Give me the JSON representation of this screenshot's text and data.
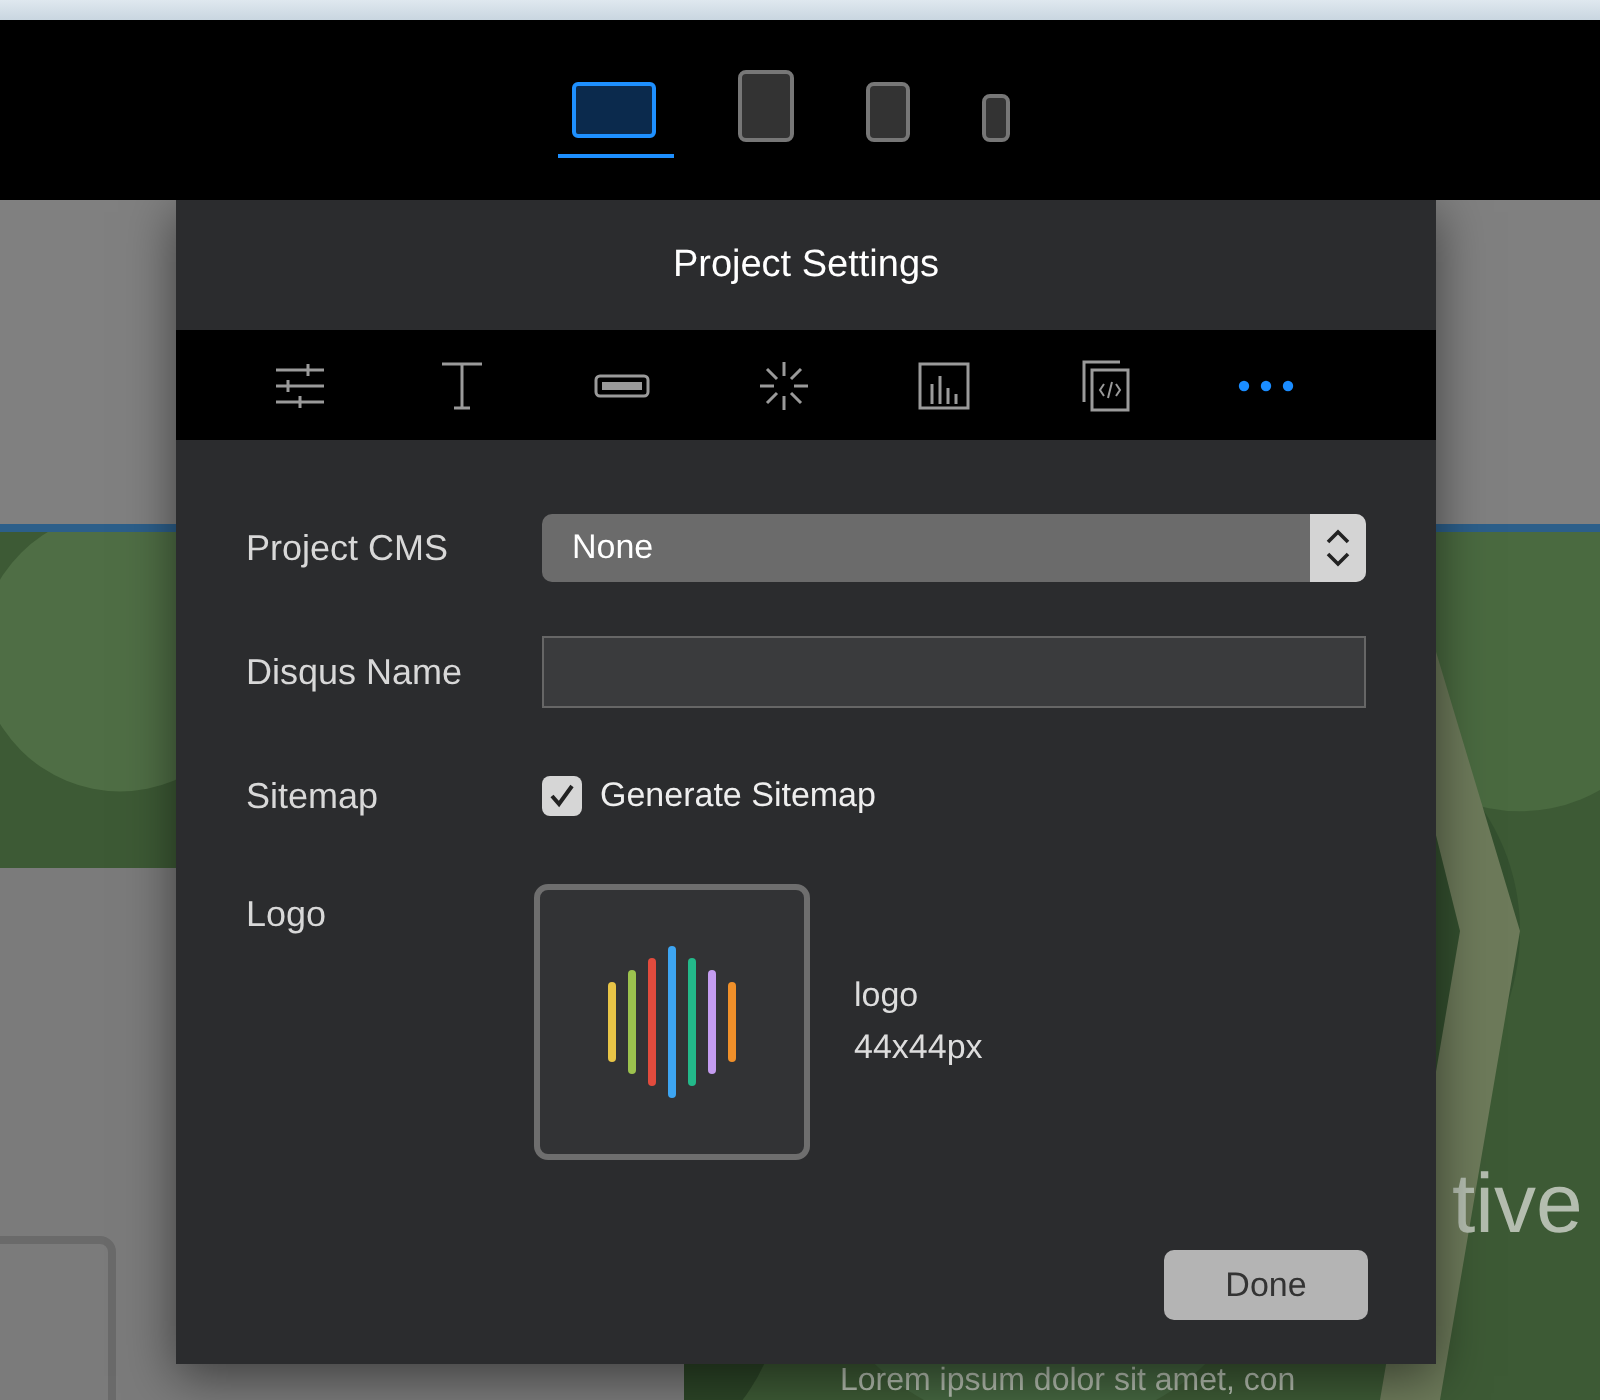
{
  "device_bar": {
    "devices": [
      {
        "kind": "laptop",
        "selected": true
      },
      {
        "kind": "tablet",
        "selected": false
      },
      {
        "kind": "small-tablet",
        "selected": false
      },
      {
        "kind": "phone",
        "selected": false
      }
    ]
  },
  "background_page": {
    "heading_fragment": "tive",
    "body_fragment": "Lorem ipsum dolor sit amet, con"
  },
  "dialog": {
    "title": "Project Settings",
    "tabs": [
      {
        "kind": "sliders",
        "selected": false
      },
      {
        "kind": "text",
        "selected": false
      },
      {
        "kind": "button",
        "selected": false
      },
      {
        "kind": "spinner",
        "selected": false
      },
      {
        "kind": "chart",
        "selected": false
      },
      {
        "kind": "code",
        "selected": false
      },
      {
        "kind": "more",
        "selected": true
      }
    ],
    "fields": [
      {
        "kind": "select",
        "label": "Project CMS",
        "value": "None"
      },
      {
        "kind": "text",
        "label": "Disqus Name"
      },
      {
        "kind": "checkbox",
        "label": "Sitemap",
        "option": "Generate Sitemap",
        "checked": true
      },
      {
        "label": "Logo",
        "file_name": "logo",
        "file_size": "44x44px"
      }
    ],
    "done_button": "Done"
  }
}
